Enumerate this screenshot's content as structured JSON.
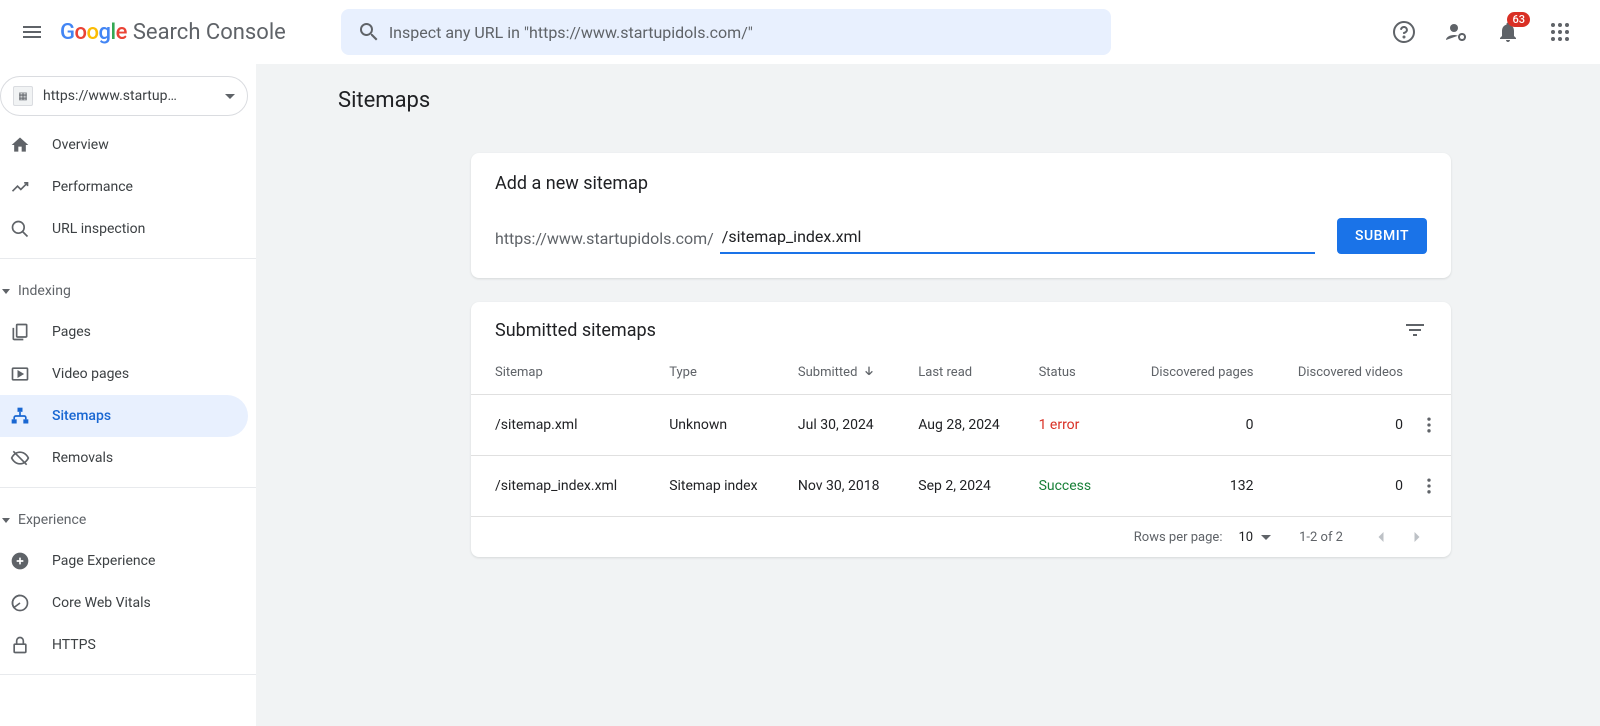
{
  "header": {
    "logo_text": "Search Console",
    "search_placeholder": "Inspect any URL in \"https://www.startupidols.com/\"",
    "notification_count": "63"
  },
  "sidebar": {
    "property": "https://www.startup…",
    "items": {
      "overview": "Overview",
      "performance": "Performance",
      "url_inspection": "URL inspection",
      "pages": "Pages",
      "video_pages": "Video pages",
      "sitemaps": "Sitemaps",
      "removals": "Removals",
      "page_experience": "Page Experience",
      "core_web_vitals": "Core Web Vitals",
      "https": "HTTPS"
    },
    "sections": {
      "indexing": "Indexing",
      "experience": "Experience"
    }
  },
  "main": {
    "title": "Sitemaps",
    "add_card": {
      "title": "Add a new sitemap",
      "url_prefix": "https://www.startupidols.com/",
      "input_value": "/sitemap_index.xml",
      "submit": "SUBMIT"
    },
    "submitted_card": {
      "title": "Submitted sitemaps",
      "columns": {
        "sitemap": "Sitemap",
        "type": "Type",
        "submitted": "Submitted",
        "last_read": "Last read",
        "status": "Status",
        "discovered_pages": "Discovered pages",
        "discovered_videos": "Discovered videos"
      },
      "rows": [
        {
          "sitemap": "/sitemap.xml",
          "type": "Unknown",
          "submitted": "Jul 30, 2024",
          "last_read": "Aug 28, 2024",
          "status": "1 error",
          "status_class": "error",
          "pages": "0",
          "videos": "0"
        },
        {
          "sitemap": "/sitemap_index.xml",
          "type": "Sitemap index",
          "submitted": "Nov 30, 2018",
          "last_read": "Sep 2, 2024",
          "status": "Success",
          "status_class": "success",
          "pages": "132",
          "videos": "0"
        }
      ],
      "pagination": {
        "rows_per_page_label": "Rows per page:",
        "rows_per_page": "10",
        "range": "1-2 of 2"
      }
    }
  }
}
